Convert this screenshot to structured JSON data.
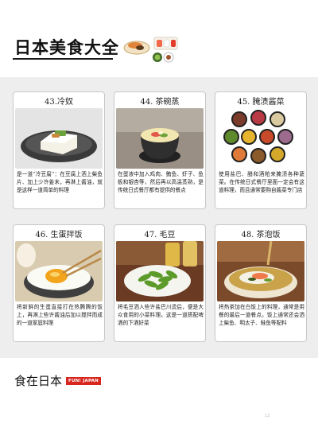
{
  "header": {
    "title": "日本美食大全"
  },
  "cards": [
    {
      "title": "43.冷奴",
      "text": "是一道“冷豆腐”：在豆腐上洒上柴鱼片、加上少许姜末，再淋上酱油，就是这样一道简单的料理"
    },
    {
      "title": "44. 茶碗蒸",
      "text": "在蛋液中加入鸡肉、鲔鱼、虾子、鱼板和银杏等，然后再以高温蒸熟，是传统日式餐厅都有提供的餐点"
    },
    {
      "title": "45. 腌渍酱菜",
      "text": "使用盐巴、醋和酒粕来腌渍各种蔬菜。在传统日式餐厅里面一定会有这道料理，而且通常要购自酱菜专门店"
    },
    {
      "title": "46. 生蛋拌饭",
      "text": "将新鲜的生蛋直接打在热腾腾的饭上，再淋上些许酱油后加以搅拌而成的一道家庭料理"
    },
    {
      "title": "47. 毛豆",
      "text": "将毛豆洒入些许盐巴川烫后，便是大众食用的小菜料理。这是一道搭配啤酒的下酒好菜"
    },
    {
      "title": "48. 茶泡饭",
      "text": "将热茶加在白饭上的料理，通常是用餐的最后一道餐点。饭上通常还会洒上柴鱼、明太子、鲑鱼等配料"
    }
  ],
  "footer": {
    "title": "食在日本",
    "brand": "FUN! JAPAN"
  },
  "page_number": "12"
}
